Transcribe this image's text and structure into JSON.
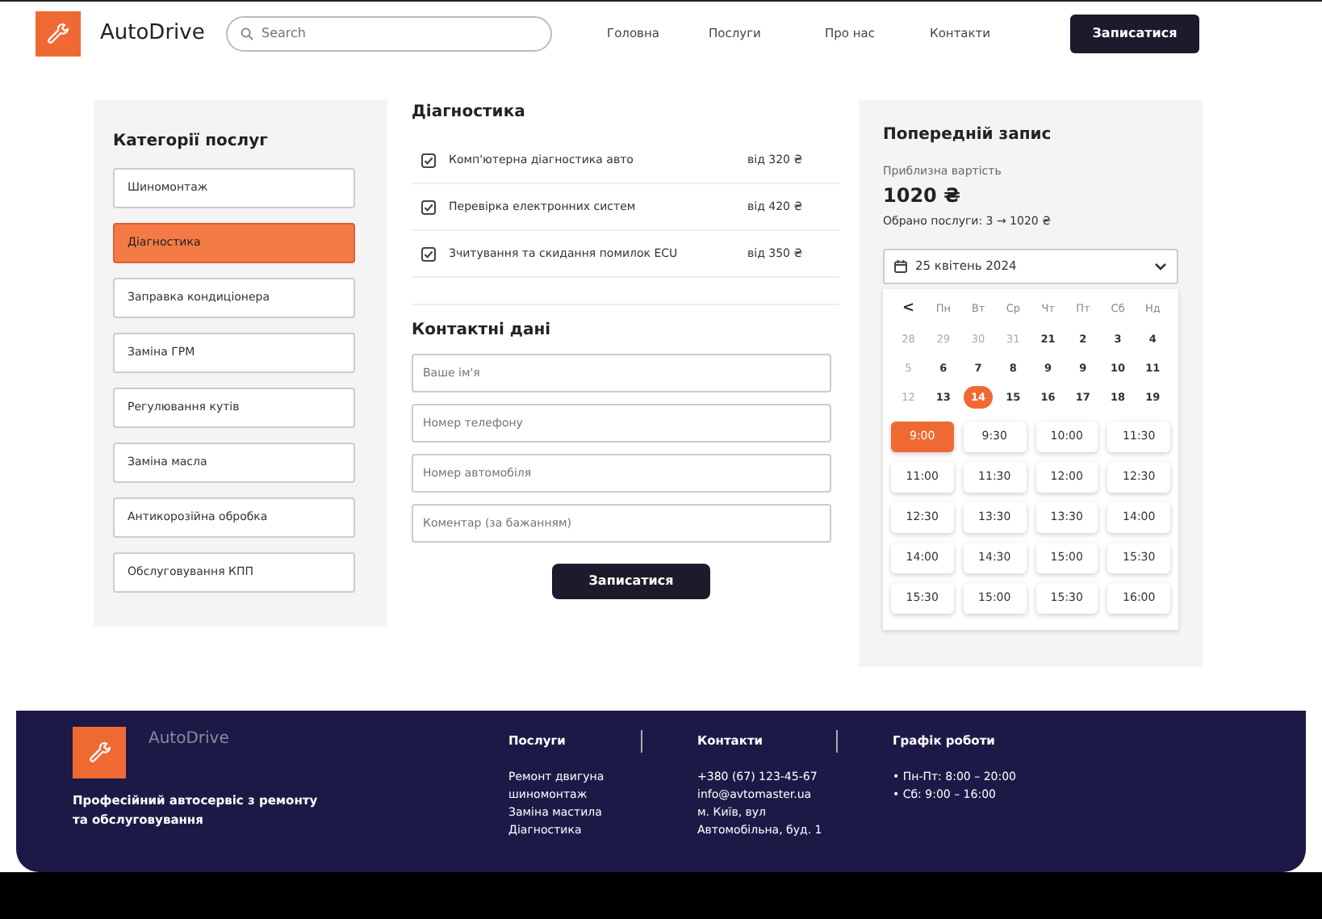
{
  "header": {
    "brand": "AutoDrive",
    "search": {
      "placeholder": "Search"
    },
    "nav": [
      {
        "label": "Головна"
      },
      {
        "label": "Послуги"
      },
      {
        "label": "Про нас"
      },
      {
        "label": "Контакти"
      }
    ],
    "cta": "Записатися"
  },
  "categories": {
    "title": "Категорії послуг",
    "items": [
      {
        "label": "Шиномонтаж",
        "selected": false
      },
      {
        "label": "Діагностика",
        "selected": true
      },
      {
        "label": "Заправка кондиціонера",
        "selected": false
      },
      {
        "label": "Заміна ГРМ",
        "selected": false
      },
      {
        "label": "Регулювання кутів",
        "selected": false
      },
      {
        "label": "Заміна масла",
        "selected": false
      },
      {
        "label": "Антикорозійна обробка",
        "selected": false
      },
      {
        "label": "Обслуговування КПП",
        "selected": false
      }
    ]
  },
  "services": {
    "title": "Діагностика",
    "items": [
      {
        "name": "Комп'ютерна діагностика авто",
        "price": "від 320 ₴",
        "checked": true
      },
      {
        "name": "Перевірка електронних систем",
        "price": "від 420 ₴",
        "checked": true
      },
      {
        "name": "Зчитування та скидання помилок ECU",
        "price": "від 350 ₴",
        "checked": true
      }
    ]
  },
  "contact": {
    "title": "Контактні дані",
    "fields": [
      {
        "placeholder": "Ваше ім'я"
      },
      {
        "placeholder": "Номер телефону"
      },
      {
        "placeholder": "Номер автомобіля"
      },
      {
        "placeholder": "Коментар (за бажанням)"
      }
    ],
    "submit": "Записатися"
  },
  "summary": {
    "title": "Попередній запис",
    "cost_label": "Приблизна вартість",
    "cost": "1020 ₴",
    "selected_info": "Обрано послуги: 3 → 1020 ₴",
    "date": "25 квітень 2024",
    "calendar": {
      "prev": "<",
      "weekdays": [
        "Пн",
        "Вт",
        "Ср",
        "Чт",
        "Пт",
        "Сб",
        "Нд"
      ],
      "days": [
        {
          "text": "28",
          "muted": true,
          "selected": false
        },
        {
          "text": "29",
          "muted": true,
          "selected": false
        },
        {
          "text": "30",
          "muted": true,
          "selected": false
        },
        {
          "text": "31",
          "muted": true,
          "selected": false
        },
        {
          "text": "21",
          "muted": false,
          "selected": false
        },
        {
          "text": "2",
          "muted": false,
          "selected": false
        },
        {
          "text": "3",
          "muted": false,
          "selected": false
        },
        {
          "text": "4",
          "muted": false,
          "selected": false
        },
        {
          "text": "5",
          "muted": true,
          "selected": false
        },
        {
          "text": "6",
          "muted": false,
          "selected": false
        },
        {
          "text": "7",
          "muted": false,
          "selected": false
        },
        {
          "text": "8",
          "muted": false,
          "selected": false
        },
        {
          "text": "9",
          "muted": false,
          "selected": false
        },
        {
          "text": "9",
          "muted": false,
          "selected": false
        },
        {
          "text": "10",
          "muted": false,
          "selected": false
        },
        {
          "text": "11",
          "muted": false,
          "selected": false
        },
        {
          "text": "12",
          "muted": true,
          "selected": false
        },
        {
          "text": "13",
          "muted": false,
          "selected": false
        },
        {
          "text": "14",
          "muted": false,
          "selected": true
        },
        {
          "text": "15",
          "muted": false,
          "selected": false
        },
        {
          "text": "16",
          "muted": false,
          "selected": false
        },
        {
          "text": "17",
          "muted": false,
          "selected": false
        },
        {
          "text": "18",
          "muted": false,
          "selected": false
        },
        {
          "text": "19",
          "muted": false,
          "selected": false
        }
      ]
    },
    "times": [
      {
        "text": "9:00",
        "selected": true
      },
      {
        "text": "9:30",
        "selected": false
      },
      {
        "text": "10:00",
        "selected": false
      },
      {
        "text": "11:30",
        "selected": false
      },
      {
        "text": "11:00",
        "selected": false
      },
      {
        "text": "11:30",
        "selected": false
      },
      {
        "text": "12:00",
        "selected": false
      },
      {
        "text": "12:30",
        "selected": false
      },
      {
        "text": "12:30",
        "selected": false
      },
      {
        "text": "13:30",
        "selected": false
      },
      {
        "text": "13:30",
        "selected": false
      },
      {
        "text": "14:00",
        "selected": false
      },
      {
        "text": "14:00",
        "selected": false
      },
      {
        "text": "14:30",
        "selected": false
      },
      {
        "text": "15:00",
        "selected": false
      },
      {
        "text": "15:30",
        "selected": false
      },
      {
        "text": "15:30",
        "selected": false
      },
      {
        "text": "15:00",
        "selected": false
      },
      {
        "text": "15:30",
        "selected": false
      },
      {
        "text": "16:00",
        "selected": false
      }
    ]
  },
  "footer": {
    "brand": "AutoDrive",
    "tagline": "Професійний автосервіс з ремонту та обслуговування",
    "columns": [
      {
        "title": "Послуги",
        "lines": [
          "Ремонт двигуна",
          "шиномонтаж",
          "Заміна мастила",
          "Діагностика"
        ]
      },
      {
        "title": "Контакти",
        "lines": [
          "+380 (67) 123-45-67",
          "info@avtomaster.ua",
          "м. Київ, вул",
          "Автомобільна, буд. 1"
        ]
      },
      {
        "title": "Графік роботи",
        "lines": [
          "• Пн-Пт: 8:00 – 20:00",
          "• Сб: 9:00 – 16:00"
        ]
      }
    ]
  }
}
